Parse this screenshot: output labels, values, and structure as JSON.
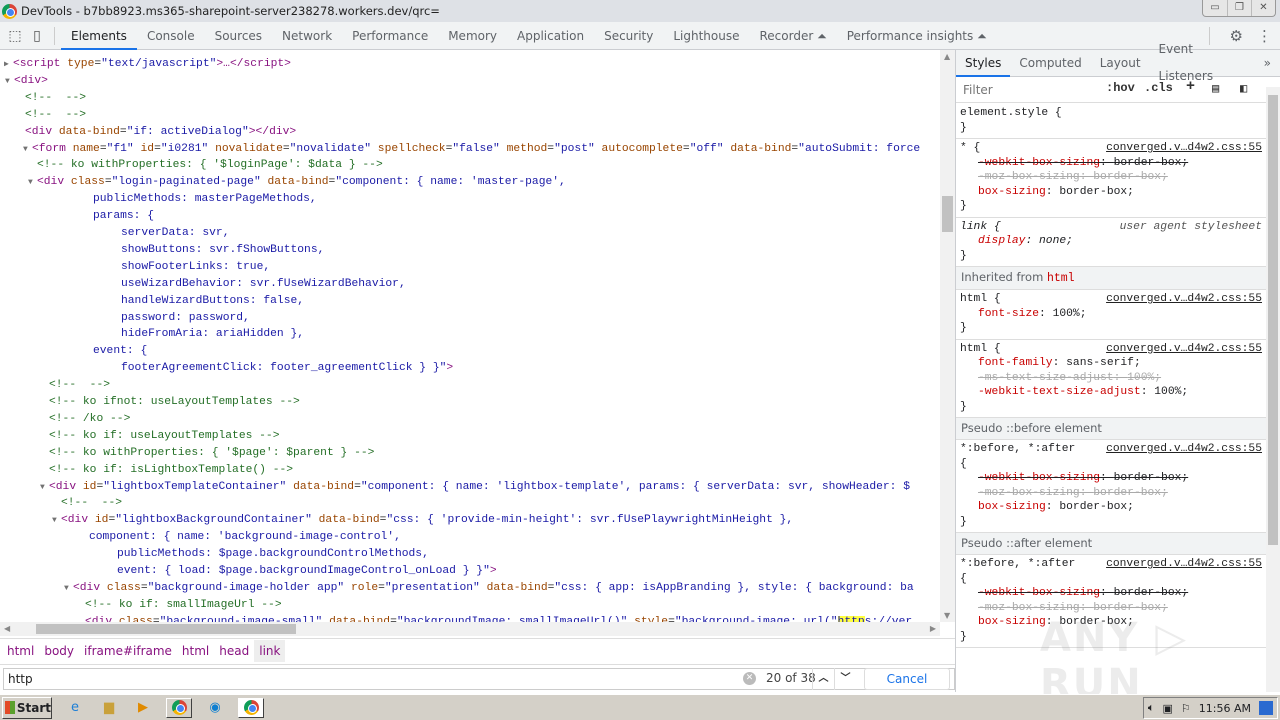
{
  "window": {
    "title": "DevTools - b7bb8923.ms365-sharepoint-server238278.workers.dev/qrc="
  },
  "toolbar": {
    "tabs": [
      "Elements",
      "Console",
      "Sources",
      "Network",
      "Performance",
      "Memory",
      "Application",
      "Security",
      "Lighthouse",
      "Recorder ⏶",
      "Performance insights ⏶"
    ],
    "active_tab": "Elements"
  },
  "code": {
    "lines": [
      [
        [
          "t",
          "<script "
        ],
        [
          "a",
          "type"
        ],
        [
          "p",
          "="
        ],
        [
          "v",
          "\"text/javascript\""
        ],
        [
          "t",
          ">…</script>"
        ]
      ],
      [
        [
          "t",
          "<div>"
        ]
      ],
      [
        [
          "c",
          "<!--  -->"
        ]
      ],
      [
        [
          "c",
          "<!--  -->"
        ]
      ],
      [
        [
          "t",
          "<div "
        ],
        [
          "a",
          "data-bind"
        ],
        [
          "p",
          "="
        ],
        [
          "v",
          "\"if: activeDialog\""
        ],
        [
          "t",
          "></div>"
        ]
      ],
      [
        [
          "t",
          "<form "
        ],
        [
          "a",
          "name"
        ],
        [
          "p",
          "="
        ],
        [
          "v",
          "\"f1\" "
        ],
        [
          "a",
          "id"
        ],
        [
          "p",
          "="
        ],
        [
          "v",
          "\"i0281\" "
        ],
        [
          "a",
          "novalidate"
        ],
        [
          "p",
          "="
        ],
        [
          "v",
          "\"novalidate\" "
        ],
        [
          "a",
          "spellcheck"
        ],
        [
          "p",
          "="
        ],
        [
          "v",
          "\"false\" "
        ],
        [
          "a",
          "method"
        ],
        [
          "p",
          "="
        ],
        [
          "v",
          "\"post\" "
        ],
        [
          "a",
          "autocomplete"
        ],
        [
          "p",
          "="
        ],
        [
          "v",
          "\"off\" "
        ],
        [
          "a",
          "data-bind"
        ],
        [
          "p",
          "="
        ],
        [
          "v",
          "\"autoSubmit: force"
        ]
      ],
      [
        [
          "c",
          "<!-- ko withProperties: { '$loginPage': $data } -->"
        ]
      ],
      [
        [
          "t",
          "<div "
        ],
        [
          "a",
          "class"
        ],
        [
          "p",
          "="
        ],
        [
          "v",
          "\"login-paginated-page\" "
        ],
        [
          "a",
          "data-bind"
        ],
        [
          "p",
          "="
        ],
        [
          "v",
          "\"component: { name: 'master-page',"
        ]
      ],
      [
        [
          "v",
          "publicMethods: masterPageMethods,"
        ]
      ],
      [
        [
          "v",
          "params: {"
        ]
      ],
      [
        [
          "v",
          "serverData: svr,"
        ]
      ],
      [
        [
          "v",
          "showButtons: svr.fShowButtons,"
        ]
      ],
      [
        [
          "v",
          "showFooterLinks: true,"
        ]
      ],
      [
        [
          "v",
          "useWizardBehavior: svr.fUseWizardBehavior,"
        ]
      ],
      [
        [
          "v",
          "handleWizardButtons: false,"
        ]
      ],
      [
        [
          "v",
          "password: password,"
        ]
      ],
      [
        [
          "v",
          "hideFromAria: ariaHidden },"
        ]
      ],
      [
        [
          "v",
          "event: {"
        ]
      ],
      [
        [
          "v",
          "footerAgreementClick: footer_agreementClick } }\""
        ],
        [
          "t",
          ">"
        ]
      ],
      [
        [
          "c",
          "<!--  -->"
        ]
      ],
      [
        [
          "c",
          "<!-- ko ifnot: useLayoutTemplates -->"
        ]
      ],
      [
        [
          "c",
          "<!-- /ko -->"
        ]
      ],
      [
        [
          "c",
          "<!-- ko if: useLayoutTemplates -->"
        ]
      ],
      [
        [
          "c",
          "<!-- ko withProperties: { '$page': $parent } -->"
        ]
      ],
      [
        [
          "c",
          "<!-- ko if: isLightboxTemplate() -->"
        ]
      ],
      [
        [
          "t",
          "<div "
        ],
        [
          "a",
          "id"
        ],
        [
          "p",
          "="
        ],
        [
          "v",
          "\"lightboxTemplateContainer\" "
        ],
        [
          "a",
          "data-bind"
        ],
        [
          "p",
          "="
        ],
        [
          "v",
          "\"component: { name: 'lightbox-template', params: { serverData: svr, showHeader: $"
        ]
      ],
      [
        [
          "c",
          "<!--  -->"
        ]
      ],
      [
        [
          "t",
          "<div "
        ],
        [
          "a",
          "id"
        ],
        [
          "p",
          "="
        ],
        [
          "v",
          "\"lightboxBackgroundContainer\" "
        ],
        [
          "a",
          "data-bind"
        ],
        [
          "p",
          "="
        ],
        [
          "v",
          "\"css: { 'provide-min-height': svr.fUsePlaywrightMinHeight },"
        ]
      ],
      [
        [
          "v",
          "component: { name: 'background-image-control',"
        ]
      ],
      [
        [
          "v",
          "publicMethods: $page.backgroundControlMethods,"
        ]
      ],
      [
        [
          "v",
          "event: { load: $page.backgroundImageControl_onLoad } }\""
        ],
        [
          "t",
          ">"
        ]
      ],
      [
        [
          "t",
          "<div "
        ],
        [
          "a",
          "class"
        ],
        [
          "p",
          "="
        ],
        [
          "v",
          "\"background-image-holder app\" "
        ],
        [
          "a",
          "role"
        ],
        [
          "p",
          "="
        ],
        [
          "v",
          "\"presentation\" "
        ],
        [
          "a",
          "data-bind"
        ],
        [
          "p",
          "="
        ],
        [
          "v",
          "\"css: { app: isAppBranding }, style: { background: ba"
        ]
      ],
      [
        [
          "c",
          "<!-- ko if: smallImageUrl -->"
        ]
      ],
      [
        [
          "t",
          "<div "
        ],
        [
          "a",
          "class"
        ],
        [
          "p",
          "="
        ],
        [
          "v",
          "\"background-image-small\" "
        ],
        [
          "a",
          "data-bind"
        ],
        [
          "p",
          "="
        ],
        [
          "v",
          "\"backgroundImage: smallImageUrl()\" "
        ],
        [
          "a",
          "style"
        ],
        [
          "p",
          "="
        ],
        [
          "v",
          "\"background-image: url(\""
        ],
        [
          "h",
          "http"
        ],
        [
          "v",
          "s://ver"
        ]
      ]
    ]
  },
  "breadcrumbs": [
    "html",
    "body",
    "iframe#iframe",
    "html",
    "head",
    "link"
  ],
  "search": {
    "value": "http",
    "count": "20 of 38",
    "cancel_label": "Cancel"
  },
  "styles": {
    "tabs": [
      "Styles",
      "Computed",
      "Layout",
      "Event Listeners",
      "»"
    ],
    "filter_placeholder": "Filter",
    "hov": ":hov",
    "cls": ".cls",
    "blocks": [
      {
        "kind": "rule",
        "selector": "element.style {",
        "source": "",
        "props": [],
        "close": "}"
      },
      {
        "kind": "rule",
        "selector": "* {",
        "source": "converged.v…d4w2.css:55",
        "props": [
          [
            "-webkit-box-sizing",
            "border-box",
            "s"
          ],
          [
            "-moz-box-sizing",
            "border-box",
            "g"
          ],
          [
            "box-sizing",
            "border-box",
            ""
          ]
        ],
        "close": "}"
      },
      {
        "kind": "rule",
        "selector": "link {",
        "source": "user agent stylesheet",
        "ua": true,
        "props": [
          [
            "display",
            "none",
            "i"
          ]
        ],
        "close": "}"
      },
      {
        "kind": "head",
        "text": "Inherited from ",
        "el": "html"
      },
      {
        "kind": "rule",
        "selector": "html {",
        "source": "converged.v…d4w2.css:55",
        "props": [
          [
            "font-size",
            "100%",
            ""
          ]
        ],
        "close": "}"
      },
      {
        "kind": "rule",
        "selector": "html {",
        "source": "converged.v…d4w2.css:55",
        "props": [
          [
            "font-family",
            "sans-serif",
            ""
          ],
          [
            "-ms-text-size-adjust",
            "100%",
            "g"
          ],
          [
            "-webkit-text-size-adjust",
            "100%",
            ""
          ]
        ],
        "close": "}"
      },
      {
        "kind": "head",
        "text": "Pseudo ::before element"
      },
      {
        "kind": "rule",
        "selector": "*:before, *:after",
        "open": "{",
        "source": "converged.v…d4w2.css:55",
        "props": [
          [
            "-webkit-box-sizing",
            "border-box",
            "s"
          ],
          [
            "-moz-box-sizing",
            "border-box",
            "g"
          ],
          [
            "box-sizing",
            "border-box",
            ""
          ]
        ],
        "close": "}"
      },
      {
        "kind": "head",
        "text": "Pseudo ::after element"
      },
      {
        "kind": "rule",
        "selector": "*:before, *:after",
        "open": "{",
        "source": "converged.v…d4w2.css:55",
        "props": [
          [
            "-webkit-box-sizing",
            "border-box",
            "s"
          ],
          [
            "-moz-box-sizing",
            "border-box",
            "g"
          ],
          [
            "box-sizing",
            "border-box",
            ""
          ]
        ],
        "close": "}"
      }
    ]
  },
  "taskbar": {
    "start_label": "Start",
    "clock": "11:56 AM"
  },
  "watermark": "ANY RUN"
}
